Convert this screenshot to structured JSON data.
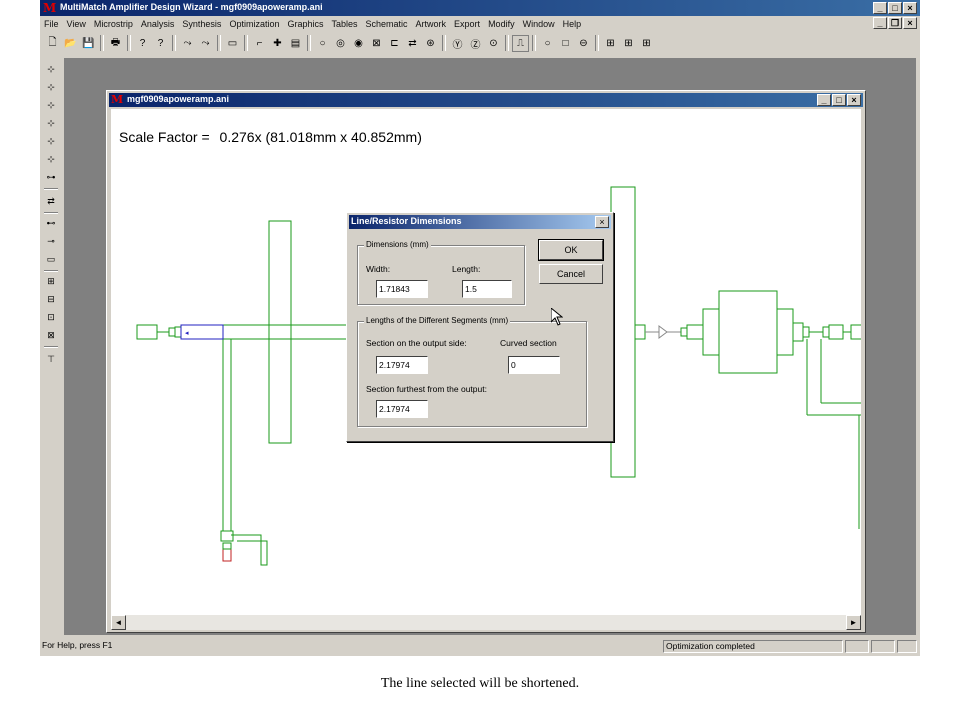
{
  "app": {
    "title": "MultiMatch Amplifier Design Wizard - mgf0909apoweramp.ani",
    "logo": "M",
    "min": "_",
    "max": "□",
    "close": "×"
  },
  "menu": [
    "File",
    "View",
    "Microstrip",
    "Analysis",
    "Synthesis",
    "Optimization",
    "Graphics",
    "Tables",
    "Schematic",
    "Artwork",
    "Export",
    "Modify",
    "Window",
    "Help"
  ],
  "mdi_buttons": {
    "min": "_",
    "restore": "❐",
    "close": "×"
  },
  "toolbar": [
    {
      "name": "new",
      "glyph": "🗋"
    },
    {
      "name": "open",
      "glyph": "📂"
    },
    {
      "name": "save",
      "glyph": "💾"
    },
    {
      "name": "print",
      "glyph": "🖶"
    },
    {
      "name": "help",
      "glyph": "?"
    },
    {
      "name": "context-help",
      "glyph": "?"
    },
    {
      "name": "arrow",
      "glyph": "⤳"
    },
    {
      "name": "arrow2",
      "glyph": "⤳"
    },
    {
      "name": "box",
      "glyph": "▭"
    },
    {
      "name": "line",
      "glyph": "⌐"
    },
    {
      "name": "cross",
      "glyph": "✚"
    },
    {
      "name": "rect",
      "glyph": "▤"
    },
    {
      "name": "circle1",
      "glyph": "○"
    },
    {
      "name": "circle2",
      "glyph": "◎"
    },
    {
      "name": "circle3",
      "glyph": "◉"
    },
    {
      "name": "xbox",
      "glyph": "⊠"
    },
    {
      "name": "pad",
      "glyph": "⊏"
    },
    {
      "name": "swap",
      "glyph": "⇄"
    },
    {
      "name": "comp",
      "glyph": "⊛"
    },
    {
      "name": "y",
      "glyph": "Ⓨ"
    },
    {
      "name": "z",
      "glyph": "Ⓩ"
    },
    {
      "name": "dot",
      "glyph": "⊙"
    },
    {
      "name": "bracket",
      "glyph": "⎍"
    },
    {
      "name": "c1",
      "glyph": "○"
    },
    {
      "name": "sq",
      "glyph": "□"
    },
    {
      "name": "c2",
      "glyph": "⊖"
    },
    {
      "name": "p1",
      "glyph": "⊞"
    },
    {
      "name": "p2",
      "glyph": "⊞"
    },
    {
      "name": "p3",
      "glyph": "⊞"
    }
  ],
  "left_toolbar": [
    "⊹",
    "⊹",
    "⊹",
    "⊹",
    "⊹",
    "⊹",
    "⊶",
    "⇄",
    "⊷",
    "⊸",
    "▭",
    "⊞",
    "⊟",
    "⊡",
    "⊠",
    "⊤"
  ],
  "child": {
    "title": "mgf0909apoweramp.ani",
    "min": "_",
    "max": "□",
    "close": "×",
    "scale_label": "Scale Factor =",
    "scale_value": "0.276x (81.018mm x 40.852mm)"
  },
  "scroll": {
    "left": "◄",
    "right": "►"
  },
  "dialog": {
    "title": "Line/Resistor Dimensions",
    "close": "×",
    "dimensions_group": "Dimensions (mm)",
    "width_label": "Width:",
    "width_value": "1.71843",
    "length_label": "Length:",
    "length_value": "1.5",
    "segments_group": "Lengths of the Different Segments (mm)",
    "output_side_label": "Section on the output side:",
    "output_side_value": "2.17974",
    "curved_label": "Curved section",
    "curved_value": "0",
    "furthest_label": "Section furthest from the output:",
    "furthest_value": "2.17974",
    "ok": "OK",
    "cancel": "Cancel"
  },
  "status": {
    "help": "For Help, press F1",
    "optimization": "Optimization completed"
  },
  "caption": "The line selected will be shortened.",
  "colors": {
    "circuit": "#1a9a1a",
    "selected": "#2020c0",
    "titlebar": "#0a246a"
  }
}
